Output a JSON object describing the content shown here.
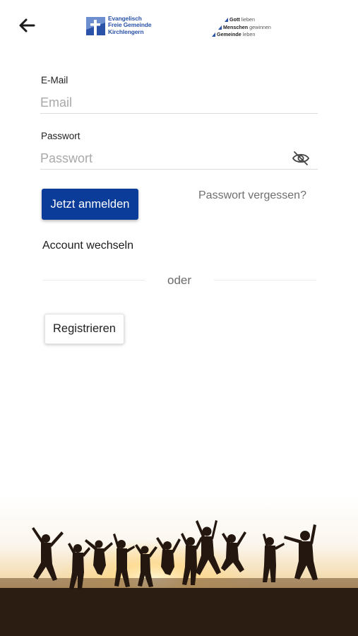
{
  "header": {
    "back_icon": "arrow-left-icon",
    "logo": {
      "line1": "Evangelisch",
      "line2": "Freie Gemeinde",
      "line3": "Kirchlengern"
    },
    "tagline": [
      {
        "bold": "Gott",
        "rest": "lieben"
      },
      {
        "bold": "Menschen",
        "rest": "gewinnen"
      },
      {
        "bold": "Gemeinde",
        "rest": "leben"
      }
    ]
  },
  "form": {
    "email_label": "E-Mail",
    "email_placeholder": "Email",
    "email_value": "",
    "password_label": "Passwort",
    "password_placeholder": "Passwort",
    "password_value": "",
    "password_toggle_icon": "eye-off-icon",
    "login_button": "Jetzt anmelden",
    "forgot_password": "Passwort vergessen?",
    "switch_account": "Account wechseln",
    "divider_text": "oder",
    "register_button": "Registrieren"
  },
  "colors": {
    "primary": "#0b3c9a",
    "logo_blue": "#2a52a8"
  }
}
